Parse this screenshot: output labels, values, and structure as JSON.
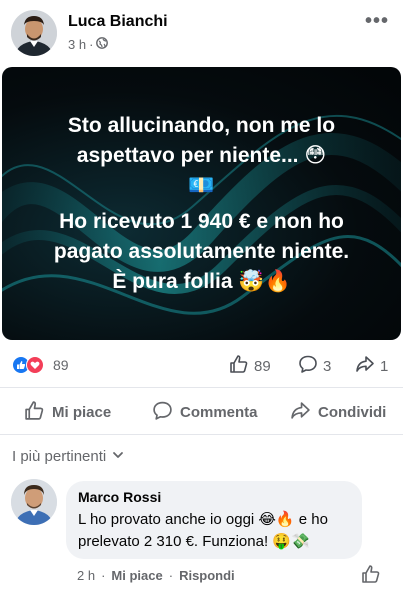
{
  "post": {
    "author": "Luca Bianchi",
    "time": "3 h",
    "meta_separator": "·",
    "privacy_icon": "globe-icon",
    "more_label": "•••",
    "image_text": {
      "line1": "Sto allucinando, non me lo",
      "line2": "aspettavo per niente... 😳",
      "line3": "💶",
      "line4": "Ho ricevuto 1 940 € e non ho",
      "line5": "pagato assolutamente niente.",
      "line6": "È pura follia 🤯🔥"
    },
    "reaction_count": "89",
    "likes_count": "89",
    "comments_count": "3",
    "shares_count": "1"
  },
  "actions": {
    "like": "Mi piace",
    "comment": "Commenta",
    "share": "Condividi"
  },
  "comments_section": {
    "sort_label": "I più pertinenti"
  },
  "comment": {
    "author": "Marco Rossi",
    "text_line1": "L ho provato anche io oggi 😂🔥 e ho",
    "text_line2": "prelevato 2 310 €. Funziona! 🤑💸",
    "time": "2 h",
    "like_label": "Mi piace",
    "reply_label": "Rispondi",
    "separator": "·"
  },
  "colors": {
    "brand_blue": "#1877f2",
    "love_red": "#f33e58",
    "secondary_text": "#65676b",
    "bubble_bg": "#f0f2f5"
  }
}
